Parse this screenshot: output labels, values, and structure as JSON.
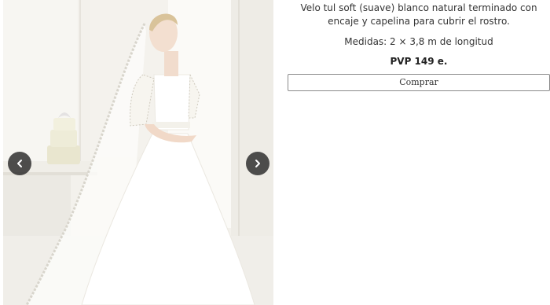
{
  "carousel": {
    "image_alt": "Novia con velo tul soft blanco natural",
    "prev_icon": "chevron-left-icon",
    "next_icon": "chevron-right-icon"
  },
  "product": {
    "description": "Velo tul soft (suave) blanco natural terminado con encaje y capelina para cubrir el rostro.",
    "measures": "Medidas: 2 × 3,8  m de longitud",
    "price": "PVP 149 e.",
    "buy_label": "Comprar"
  },
  "colors": {
    "nav_button_bg": "#282828",
    "button_border": "#8a8a8a",
    "text": "#333333"
  }
}
